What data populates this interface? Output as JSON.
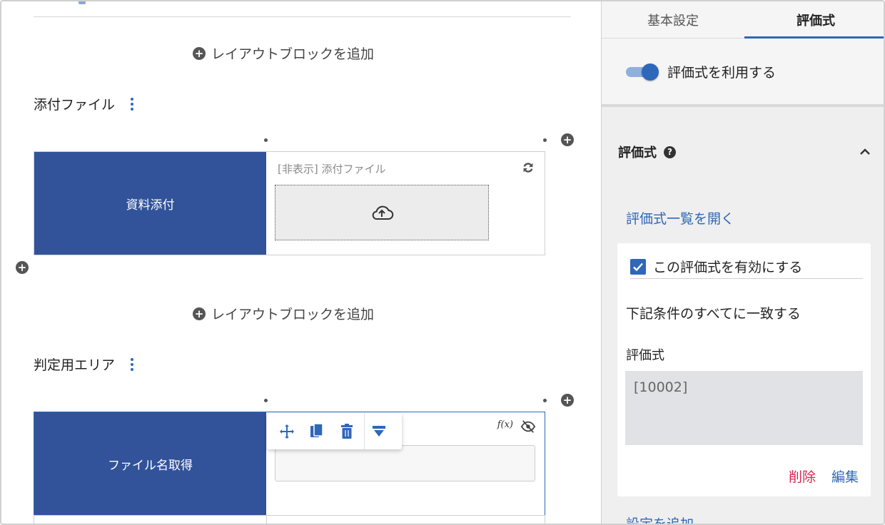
{
  "canvas": {
    "add_layout_block_label": "レイアウトブロックを追加",
    "sections": [
      {
        "title": "添付ファイル",
        "field_label": "資料添付",
        "hidden_field_text": "[非表示] 添付ファイル"
      },
      {
        "title": "判定用エリア",
        "field_label": "ファイル名取得"
      }
    ],
    "fx_label": "f(x)",
    "icons": {
      "plus": "plus-circle-icon",
      "menu": "vertical-dots-icon",
      "sync": "sync-icon",
      "upload": "cloud-upload-icon",
      "move": "move-icon",
      "copy": "copy-icon",
      "delete": "trash-icon",
      "insert_below": "insert-below-icon",
      "hidden": "eye-off-icon"
    }
  },
  "panel": {
    "tabs": [
      {
        "label": "基本設定",
        "active": false
      },
      {
        "label": "評価式",
        "active": true
      }
    ],
    "toggle_label": "評価式を利用する",
    "toggle_on": true,
    "section_title": "評価式",
    "open_list_link": "評価式一覧を開く",
    "card": {
      "enable_label": "この評価式を有効にする",
      "enabled": true,
      "condition_text": "下記条件のすべてに一致する",
      "expression_label": "評価式",
      "expression_value": "[10002]",
      "delete_label": "削除",
      "edit_label": "編集"
    },
    "add_setting_link": "設定を追加"
  },
  "colors": {
    "accent": "#2f67b9",
    "field_label_bg": "#32539a",
    "delete": "#d8264f",
    "panel_bg": "#efefef"
  }
}
